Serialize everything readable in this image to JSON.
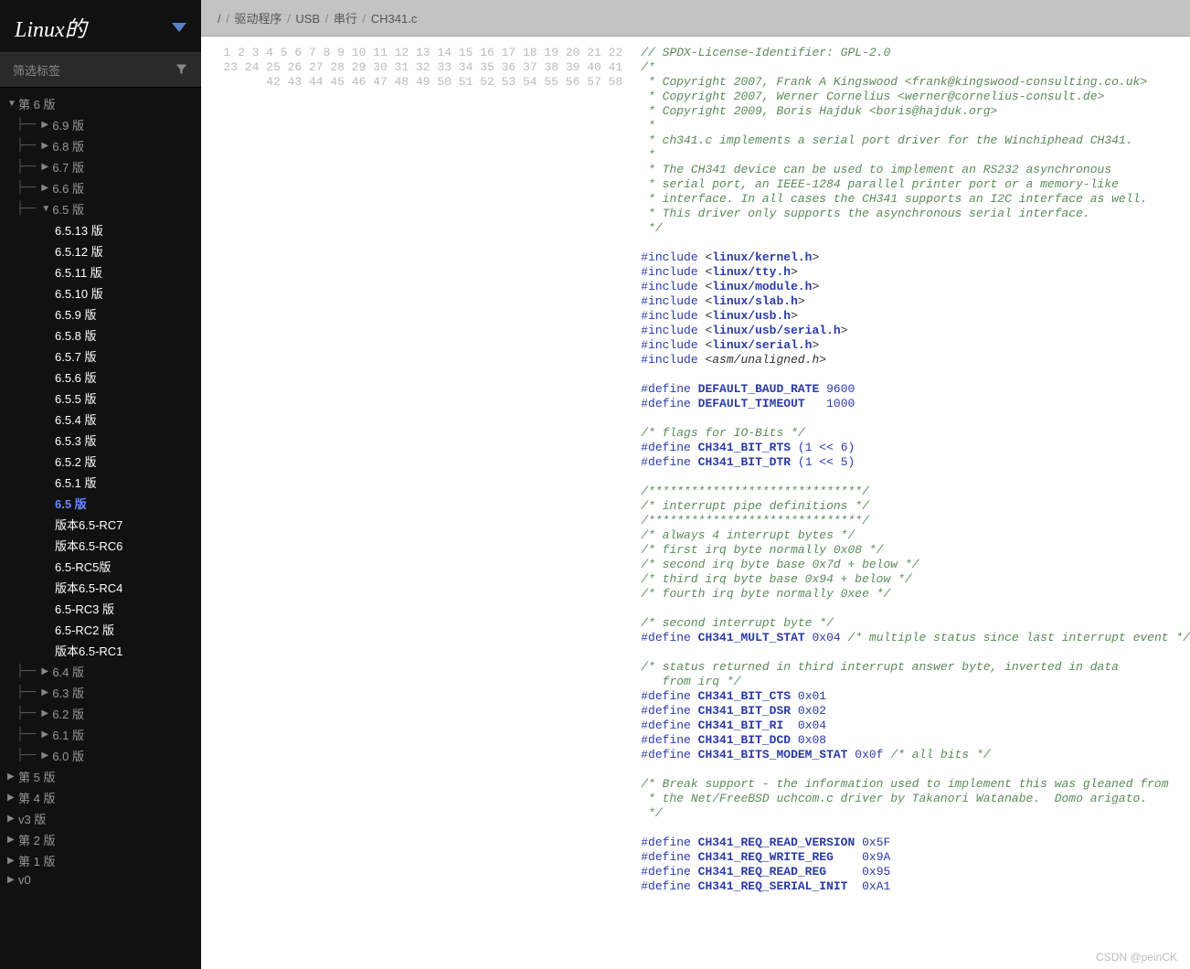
{
  "sidebar": {
    "title": "Linux的",
    "filter_placeholder": "筛选标签",
    "tree": [
      {
        "label": "第 6 版",
        "depth": 0,
        "exp": "open",
        "children": [
          {
            "label": "6.9 版",
            "depth": 1,
            "exp": "closed"
          },
          {
            "label": "6.8 版",
            "depth": 1,
            "exp": "closed"
          },
          {
            "label": "6.7 版",
            "depth": 1,
            "exp": "closed"
          },
          {
            "label": "6.6 版",
            "depth": 1,
            "exp": "closed"
          },
          {
            "label": "6.5 版",
            "depth": 1,
            "exp": "open",
            "children": [
              {
                "label": "6.5.13 版",
                "depth": 2,
                "bright": true
              },
              {
                "label": "6.5.12 版",
                "depth": 2,
                "bright": true
              },
              {
                "label": "6.5.11 版",
                "depth": 2,
                "bright": true
              },
              {
                "label": "6.5.10 版",
                "depth": 2,
                "bright": true
              },
              {
                "label": "6.5.9 版",
                "depth": 2,
                "bright": true
              },
              {
                "label": "6.5.8 版",
                "depth": 2,
                "bright": true
              },
              {
                "label": "6.5.7 版",
                "depth": 2,
                "bright": true
              },
              {
                "label": "6.5.6 版",
                "depth": 2,
                "bright": true
              },
              {
                "label": "6.5.5 版",
                "depth": 2,
                "bright": true
              },
              {
                "label": "6.5.4 版",
                "depth": 2,
                "bright": true
              },
              {
                "label": "6.5.3 版",
                "depth": 2,
                "bright": true
              },
              {
                "label": "6.5.2 版",
                "depth": 2,
                "bright": true
              },
              {
                "label": "6.5.1 版",
                "depth": 2,
                "bright": true
              },
              {
                "label": "6.5 版",
                "depth": 2,
                "active": true
              },
              {
                "label": "版本6.5-RC7",
                "depth": 2,
                "bright": true
              },
              {
                "label": "版本6.5-RC6",
                "depth": 2,
                "bright": true
              },
              {
                "label": "6.5-RC5版",
                "depth": 2,
                "bright": true
              },
              {
                "label": "版本6.5-RC4",
                "depth": 2,
                "bright": true
              },
              {
                "label": "6.5-RC3 版",
                "depth": 2,
                "bright": true
              },
              {
                "label": "6.5-RC2 版",
                "depth": 2,
                "bright": true
              },
              {
                "label": "版本6.5-RC1",
                "depth": 2,
                "bright": true
              }
            ]
          },
          {
            "label": "6.4 版",
            "depth": 1,
            "exp": "closed"
          },
          {
            "label": "6.3 版",
            "depth": 1,
            "exp": "closed"
          },
          {
            "label": "6.2 版",
            "depth": 1,
            "exp": "closed"
          },
          {
            "label": "6.1 版",
            "depth": 1,
            "exp": "closed"
          },
          {
            "label": "6.0 版",
            "depth": 1,
            "exp": "closed"
          }
        ]
      },
      {
        "label": "第 5 版",
        "depth": 0,
        "exp": "closed"
      },
      {
        "label": "第 4 版",
        "depth": 0,
        "exp": "closed"
      },
      {
        "label": "v3 版",
        "depth": 0,
        "exp": "closed"
      },
      {
        "label": "第 2 版",
        "depth": 0,
        "exp": "closed"
      },
      {
        "label": "第 1 版",
        "depth": 0,
        "exp": "closed"
      },
      {
        "label": "v0",
        "depth": 0,
        "exp": "closed"
      }
    ]
  },
  "breadcrumbs": [
    "/",
    "驱动程序",
    "USB",
    "串行",
    "CH341.c"
  ],
  "code_lines": [
    {
      "n": 1,
      "t": "comment",
      "s": "// SPDX-License-Identifier: GPL-2.0"
    },
    {
      "n": 2,
      "t": "comment",
      "s": "/*"
    },
    {
      "n": 3,
      "t": "comment",
      "s": " * Copyright 2007, Frank A Kingswood <frank@kingswood-consulting.co.uk>"
    },
    {
      "n": 4,
      "t": "comment",
      "s": " * Copyright 2007, Werner Cornelius <werner@cornelius-consult.de>"
    },
    {
      "n": 5,
      "t": "comment",
      "s": " * Copyright 2009, Boris Hajduk <boris@hajduk.org>"
    },
    {
      "n": 6,
      "t": "comment",
      "s": " *"
    },
    {
      "n": 7,
      "t": "comment",
      "s": " * ch341.c implements a serial port driver for the Winchiphead CH341."
    },
    {
      "n": 8,
      "t": "comment",
      "s": " *"
    },
    {
      "n": 9,
      "t": "comment",
      "s": " * The CH341 device can be used to implement an RS232 asynchronous"
    },
    {
      "n": 10,
      "t": "comment",
      "s": " * serial port, an IEEE-1284 parallel printer port or a memory-like"
    },
    {
      "n": 11,
      "t": "comment",
      "s": " * interface. In all cases the CH341 supports an I2C interface as well."
    },
    {
      "n": 12,
      "t": "comment",
      "s": " * This driver only supports the asynchronous serial interface."
    },
    {
      "n": 13,
      "t": "comment",
      "s": " */"
    },
    {
      "n": 14,
      "t": "blank",
      "s": ""
    },
    {
      "n": 15,
      "t": "include",
      "h": "linux/kernel.h"
    },
    {
      "n": 16,
      "t": "include",
      "h": "linux/tty.h"
    },
    {
      "n": 17,
      "t": "include",
      "h": "linux/module.h"
    },
    {
      "n": 18,
      "t": "include",
      "h": "linux/slab.h"
    },
    {
      "n": 19,
      "t": "include",
      "h": "linux/usb.h"
    },
    {
      "n": 20,
      "t": "include",
      "h": "linux/usb/serial.h"
    },
    {
      "n": 21,
      "t": "include",
      "h": "linux/serial.h"
    },
    {
      "n": 22,
      "t": "include_plain",
      "h": "asm/unaligned.h"
    },
    {
      "n": 23,
      "t": "blank",
      "s": ""
    },
    {
      "n": 24,
      "t": "define",
      "m": "DEFAULT_BAUD_RATE",
      "v": "9600"
    },
    {
      "n": 25,
      "t": "define",
      "m": "DEFAULT_TIMEOUT",
      "v": "  1000"
    },
    {
      "n": 26,
      "t": "blank",
      "s": ""
    },
    {
      "n": 27,
      "t": "comment",
      "s": "/* flags for IO-Bits */"
    },
    {
      "n": 28,
      "t": "define",
      "m": "CH341_BIT_RTS",
      "v": "(1 << 6)"
    },
    {
      "n": 29,
      "t": "define",
      "m": "CH341_BIT_DTR",
      "v": "(1 << 5)"
    },
    {
      "n": 30,
      "t": "blank",
      "s": ""
    },
    {
      "n": 31,
      "t": "comment",
      "s": "/******************************/"
    },
    {
      "n": 32,
      "t": "comment",
      "s": "/* interrupt pipe definitions */"
    },
    {
      "n": 33,
      "t": "comment",
      "s": "/******************************/"
    },
    {
      "n": 34,
      "t": "comment",
      "s": "/* always 4 interrupt bytes */"
    },
    {
      "n": 35,
      "t": "comment",
      "s": "/* first irq byte normally 0x08 */"
    },
    {
      "n": 36,
      "t": "comment",
      "s": "/* second irq byte base 0x7d + below */"
    },
    {
      "n": 37,
      "t": "comment",
      "s": "/* third irq byte base 0x94 + below */"
    },
    {
      "n": 38,
      "t": "comment",
      "s": "/* fourth irq byte normally 0xee */"
    },
    {
      "n": 39,
      "t": "blank",
      "s": ""
    },
    {
      "n": 40,
      "t": "comment",
      "s": "/* second interrupt byte */"
    },
    {
      "n": 41,
      "t": "define_c",
      "m": "CH341_MULT_STAT",
      "v": "0x04",
      "c": "/* multiple status since last interrupt event */"
    },
    {
      "n": 42,
      "t": "blank",
      "s": ""
    },
    {
      "n": 43,
      "t": "comment",
      "s": "/* status returned in third interrupt answer byte, inverted in data"
    },
    {
      "n": 44,
      "t": "comment",
      "s": "   from irq */"
    },
    {
      "n": 45,
      "t": "define",
      "m": "CH341_BIT_CTS",
      "v": "0x01"
    },
    {
      "n": 46,
      "t": "define",
      "m": "CH341_BIT_DSR",
      "v": "0x02"
    },
    {
      "n": 47,
      "t": "define",
      "m": "CH341_BIT_RI ",
      "v": "0x04"
    },
    {
      "n": 48,
      "t": "define",
      "m": "CH341_BIT_DCD",
      "v": "0x08"
    },
    {
      "n": 49,
      "t": "define_c",
      "m": "CH341_BITS_MODEM_STAT",
      "v": "0x0f",
      "c": "/* all bits */"
    },
    {
      "n": 50,
      "t": "blank",
      "s": ""
    },
    {
      "n": 51,
      "t": "comment",
      "s": "/* Break support - the information used to implement this was gleaned from"
    },
    {
      "n": 52,
      "t": "comment",
      "s": " * the Net/FreeBSD uchcom.c driver by Takanori Watanabe.  Domo arigato."
    },
    {
      "n": 53,
      "t": "comment",
      "s": " */"
    },
    {
      "n": 54,
      "t": "blank",
      "s": ""
    },
    {
      "n": 55,
      "t": "define",
      "m": "CH341_REQ_READ_VERSION",
      "v": "0x5F"
    },
    {
      "n": 56,
      "t": "define",
      "m": "CH341_REQ_WRITE_REG   ",
      "v": "0x9A"
    },
    {
      "n": 57,
      "t": "define",
      "m": "CH341_REQ_READ_REG    ",
      "v": "0x95"
    },
    {
      "n": 58,
      "t": "define",
      "m": "CH341_REQ_SERIAL_INIT ",
      "v": "0xA1"
    }
  ],
  "watermark": "CSDN @peinCK"
}
